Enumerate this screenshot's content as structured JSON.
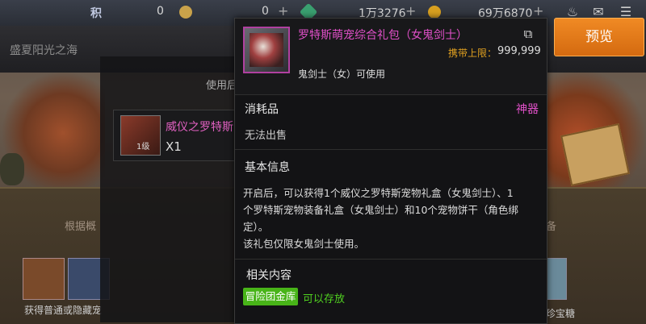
{
  "topbar": {
    "partial_label": "积",
    "currency1_value": "0",
    "currency2_value": "0",
    "currency3_value": "1万3276",
    "currency4_value": "69万6870",
    "plus_symbol": "+",
    "icons": [
      "pot-icon",
      "mail-icon",
      "menu-icon"
    ]
  },
  "region_label": "盛夏阳光之海",
  "preview_button_label": "预览",
  "background_dialog": {
    "label": "使用后",
    "item_name": "威仪之罗特斯",
    "item_level": "1级",
    "item_qty": "X1"
  },
  "background_panel": {
    "left_text": "根据概",
    "right_text": "备",
    "left_caption": "获得普通或隐藏宠",
    "right_caption": "珍宝糖"
  },
  "tooltip": {
    "title": "罗特斯萌宠综合礼包（女鬼剑士）",
    "carry_limit_label": "携带上限：",
    "carry_limit_value": "999,999",
    "usable_by": "鬼剑士（女）可使用",
    "category": "消耗品",
    "rarity": "神器",
    "rarity_color": "#e050c8",
    "not_sellable": "无法出售",
    "basic_info_label": "基本信息",
    "description_lines": [
      "开启后，可以获得1个威仪之罗特斯宠物礼盒（女鬼剑士）、1",
      "个罗特斯宠物装备礼盒（女鬼剑士）和10个宠物饼干（角色绑",
      "定）。",
      "该礼包仅限女鬼剑士使用。"
    ],
    "related_label": "相关内容",
    "related_tag": "冒险团金库",
    "related_tag_text": "可以存放"
  }
}
